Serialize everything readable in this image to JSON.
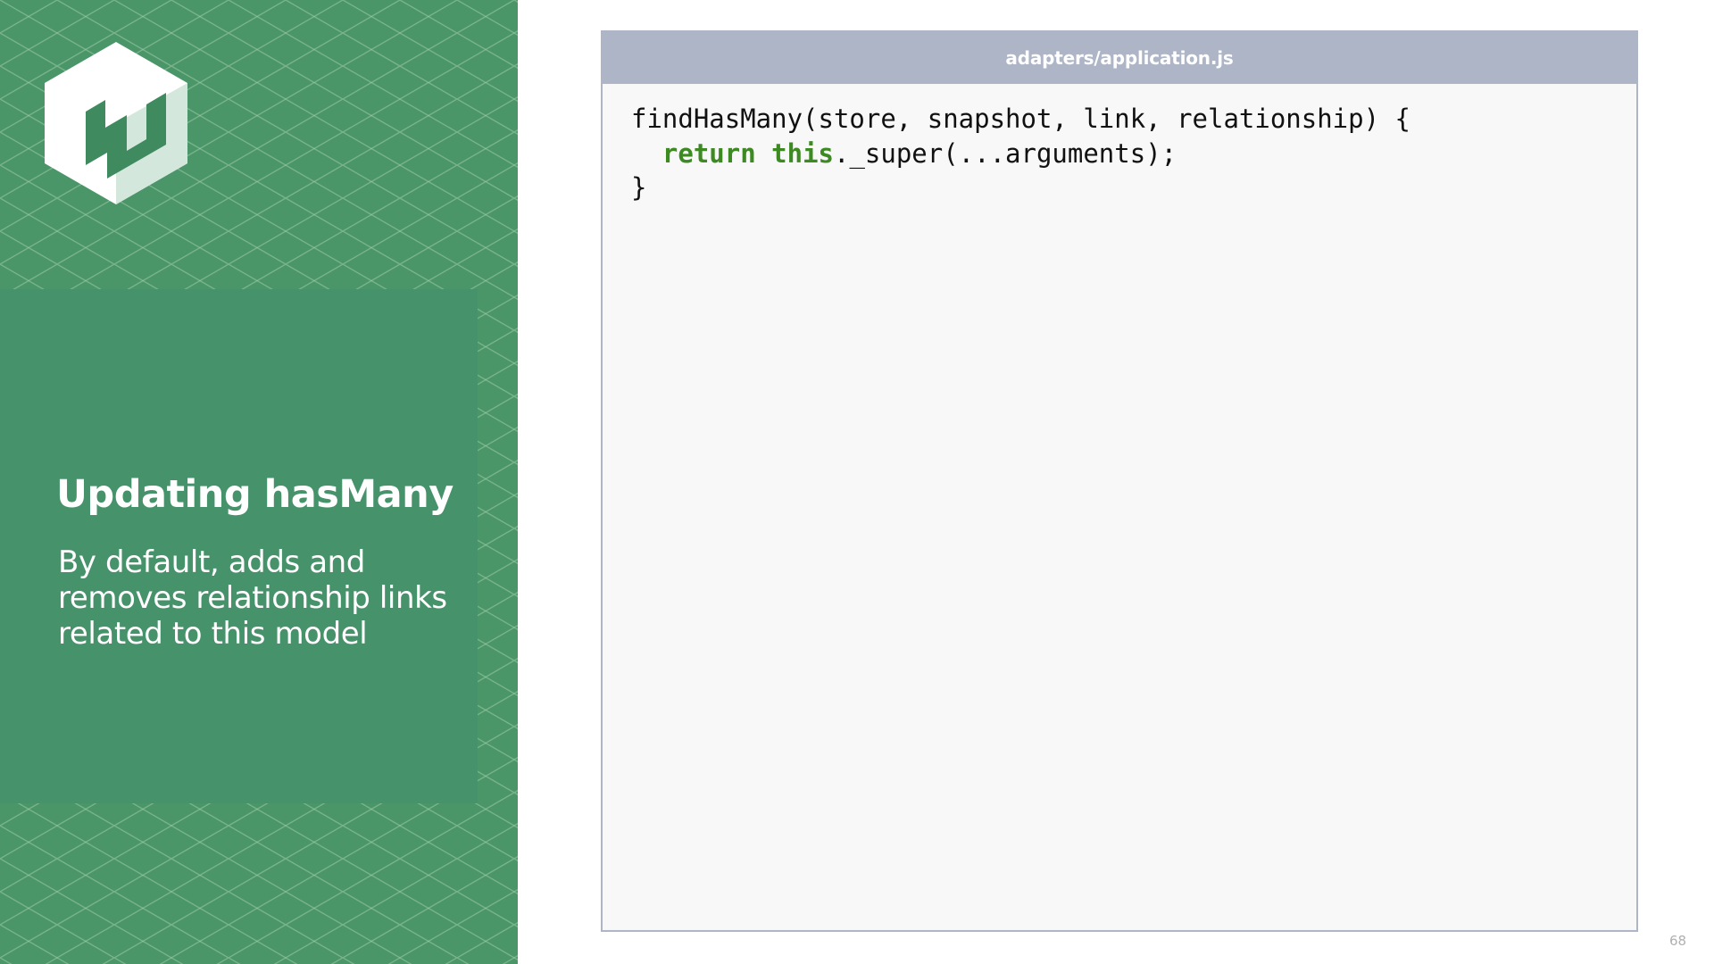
{
  "slide": {
    "title": "Updating hasMany",
    "description": "By default, adds and removes relationship links related to this model",
    "page_number": "68"
  },
  "code_card": {
    "filename": "adapters/application.js",
    "lines": [
      {
        "tokens": [
          {
            "text": "findHasMany(store, snapshot, link, relationship) {",
            "keyword": false
          }
        ]
      },
      {
        "tokens": [
          {
            "text": "  ",
            "keyword": false
          },
          {
            "text": "return",
            "keyword": true
          },
          {
            "text": " ",
            "keyword": false
          },
          {
            "text": "this",
            "keyword": true
          },
          {
            "text": "._super(...arguments);",
            "keyword": false
          }
        ]
      },
      {
        "tokens": [
          {
            "text": "}",
            "keyword": false
          }
        ]
      }
    ]
  },
  "colors": {
    "sidebar_background": "#4a9669",
    "panel_background": "#46926a",
    "header_background": "#adb5c6",
    "code_background": "#f8f8f8",
    "keyword": "#3d8a23"
  },
  "icons": {
    "logo": "hexagon-n-logo-icon"
  }
}
